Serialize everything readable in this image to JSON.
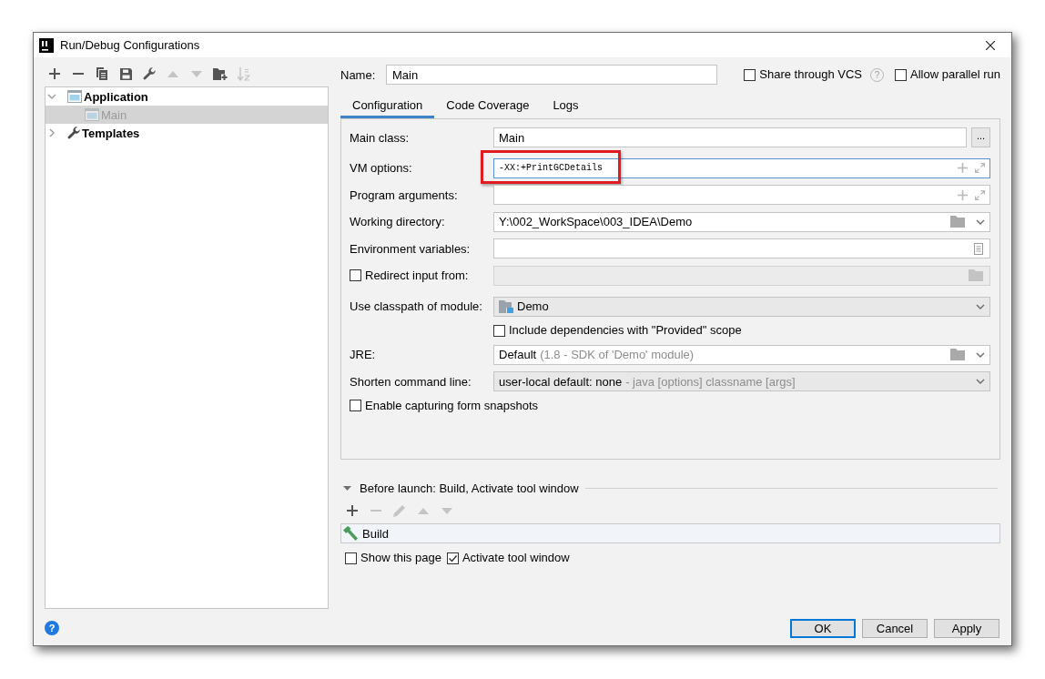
{
  "window": {
    "title": "Run/Debug Configurations"
  },
  "toolbar": [
    {
      "kind": "add",
      "disabled": false
    },
    {
      "kind": "remove",
      "disabled": false
    },
    {
      "kind": "copy",
      "disabled": false
    },
    {
      "kind": "save",
      "disabled": false
    },
    {
      "kind": "templates",
      "disabled": false
    },
    {
      "kind": "up",
      "disabled": true
    },
    {
      "kind": "down",
      "disabled": true
    },
    {
      "kind": "folder",
      "disabled": false
    },
    {
      "kind": "sort",
      "disabled": true
    }
  ],
  "tree": [
    {
      "kind": "type",
      "label": "Application",
      "expanded": true,
      "selected": false,
      "children": [
        {
          "kind": "configuration",
          "label": "Main",
          "selected": true,
          "temporary": true
        }
      ]
    },
    {
      "kind": "templates",
      "label": "Templates",
      "expanded": false,
      "selected": false
    }
  ],
  "name_field": {
    "label": "Name:",
    "value": "Main"
  },
  "share_through_vcs": {
    "label": "Share through VCS",
    "checked": false,
    "help": "?"
  },
  "allow_parallel_run": {
    "label": "Allow parallel run",
    "checked": false
  },
  "tabs": [
    {
      "label": "Configuration",
      "selected": true
    },
    {
      "label": "Code Coverage",
      "selected": false
    },
    {
      "label": "Logs",
      "selected": false
    }
  ],
  "form": [
    {
      "kind": "class",
      "label": "Main class:",
      "value": "Main",
      "button": "...",
      "focused": false,
      "highlighted": false
    },
    {
      "kind": "expandable",
      "label": "VM options:",
      "value": "-XX:+PrintGCDetails",
      "focused": true,
      "highlighted": true
    },
    {
      "kind": "expandable",
      "label": "Program arguments:",
      "focused": false,
      "highlighted": false
    },
    {
      "kind": "directory",
      "label": "Working directory:",
      "value": "Y:\\002_WorkSpace\\003_IDEA\\Demo",
      "focused": false,
      "highlighted": false
    },
    {
      "kind": "environment",
      "label": "Environment variables:",
      "focused": false,
      "highlighted": false
    },
    {
      "kind": "redirect",
      "label": "Redirect input from:",
      "checked": false,
      "focused": false,
      "highlighted": false
    },
    {
      "kind": "module",
      "label": "Use classpath of module:",
      "value": "Demo",
      "focused": false,
      "highlighted": false
    },
    {
      "kind": "option",
      "label": "Include dependencies with \"Provided\" scope",
      "checked": false,
      "highlighted": false
    },
    {
      "kind": "jre",
      "label": "JRE:",
      "value": "Default",
      "hint": "(1.8 - SDK of 'Demo' module)",
      "focused": false,
      "highlighted": false
    },
    {
      "kind": "combo",
      "label": "Shorten command line:",
      "value": "user-local default: none",
      "hint": "- java [options] classname [args]",
      "focused": false,
      "highlighted": false
    },
    {
      "kind": "checkbox",
      "label": "Enable capturing form snapshots",
      "checked": false,
      "highlighted": false
    }
  ],
  "before_launch": {
    "title": "Before launch: Build, Activate tool window",
    "expanded": true,
    "toolbar": [
      {
        "kind": "add",
        "disabled": false
      },
      {
        "kind": "remove",
        "disabled": true
      },
      {
        "kind": "edit",
        "disabled": true
      },
      {
        "kind": "up",
        "disabled": true
      },
      {
        "kind": "down",
        "disabled": true
      }
    ],
    "tasks": [
      {
        "kind": "build",
        "label": "Build"
      }
    ],
    "show_this_page": {
      "label": "Show this page",
      "checked": false
    },
    "activate_tool_window": {
      "label": "Activate tool window",
      "checked": true
    }
  },
  "help_button": "?",
  "buttons": [
    {
      "label": "OK",
      "default": true
    },
    {
      "label": "Cancel",
      "default": false
    },
    {
      "label": "Apply",
      "default": false
    }
  ]
}
